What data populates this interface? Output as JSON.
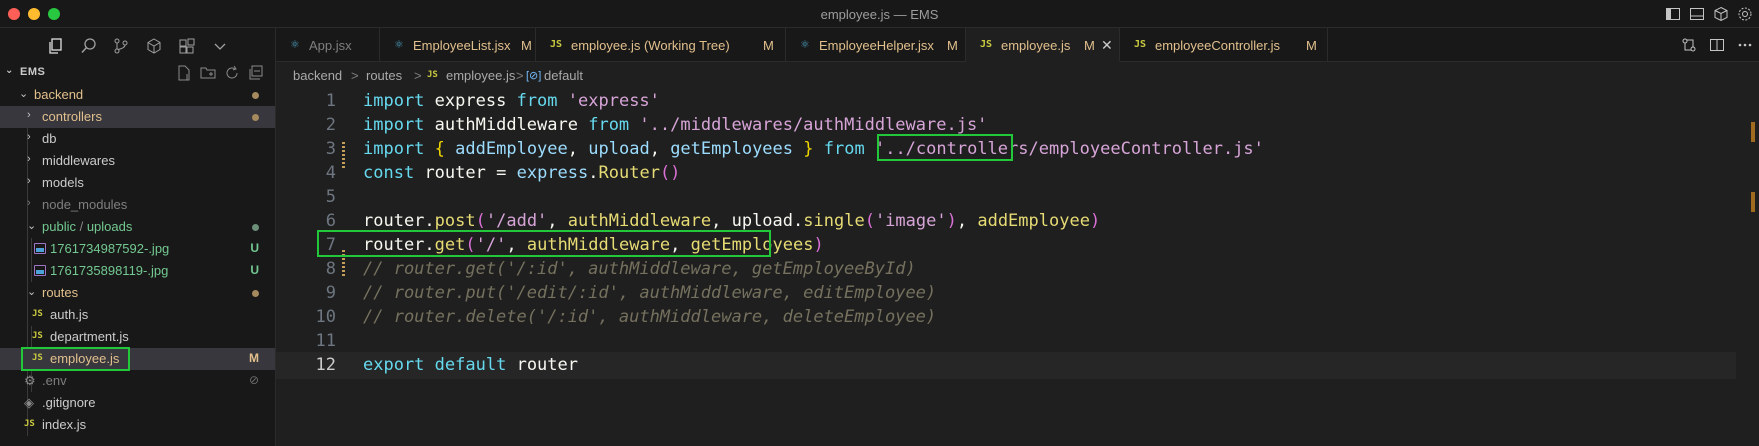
{
  "window": {
    "title": "employee.js — EMS"
  },
  "sidebar": {
    "section_title": "EMS",
    "tree": [
      {
        "label": "backend",
        "kind": "folder",
        "open": true,
        "depth": 0,
        "status": "dot"
      },
      {
        "label": "controllers",
        "kind": "folder",
        "open": false,
        "depth": 1,
        "status": "dot",
        "selected": true
      },
      {
        "label": "db",
        "kind": "folder",
        "open": false,
        "depth": 1
      },
      {
        "label": "middlewares",
        "kind": "folder",
        "open": false,
        "depth": 1
      },
      {
        "label": "models",
        "kind": "folder",
        "open": false,
        "depth": 1
      },
      {
        "label": "node_modules",
        "kind": "folder",
        "open": false,
        "depth": 1,
        "dim": true
      },
      {
        "label": "public",
        "label2": "uploads",
        "kind": "folder",
        "open": true,
        "depth": 1,
        "status": "dot-gray"
      },
      {
        "label": "1761734987592-.jpg",
        "kind": "image",
        "depth": 2,
        "badge": "U"
      },
      {
        "label": "1761735898119-.jpg",
        "kind": "image",
        "depth": 2,
        "badge": "U"
      },
      {
        "label": "routes",
        "kind": "folder",
        "open": true,
        "depth": 1,
        "status": "dot"
      },
      {
        "label": "auth.js",
        "kind": "js",
        "depth": 2
      },
      {
        "label": "department.js",
        "kind": "js",
        "depth": 2
      },
      {
        "label": "employee.js",
        "kind": "js",
        "depth": 2,
        "badge": "M",
        "active": true
      },
      {
        "label": ".env",
        "kind": "gear",
        "depth": 1,
        "badge": "⊘"
      },
      {
        "label": ".gitignore",
        "kind": "gear",
        "depth": 1
      },
      {
        "label": "index.js",
        "kind": "js",
        "depth": 1
      }
    ]
  },
  "tabs": [
    {
      "label": "App.jsx",
      "icon": "react-icon",
      "modified": ""
    },
    {
      "label": "EmployeeList.jsx",
      "icon": "react-icon",
      "modified": "M"
    },
    {
      "label": "employee.js (Working Tree)",
      "icon": "js-icon",
      "modified": "M"
    },
    {
      "label": "EmployeeHelper.jsx",
      "icon": "react-icon",
      "modified": "M"
    },
    {
      "label": "employee.js",
      "icon": "js-icon",
      "modified": "M",
      "active": true
    },
    {
      "label": "employeeController.js",
      "icon": "js-icon",
      "modified": "M"
    }
  ],
  "breadcrumb": {
    "items": [
      "backend",
      "routes",
      "employee.js",
      "default"
    ],
    "separator": ">"
  },
  "editor": {
    "current_line": 12,
    "lines": [
      {
        "n": "1",
        "text": "import express from 'express'"
      },
      {
        "n": "2",
        "text": "import authMiddleware from '../middlewares/authMiddleware.js'"
      },
      {
        "n": "3",
        "text": "import { addEmployee, upload, getEmployees } from '../controllers/employeeController.js'"
      },
      {
        "n": "4",
        "text": "const router = express.Router()"
      },
      {
        "n": "5",
        "text": ""
      },
      {
        "n": "6",
        "text": "router.post('/add', authMiddleware, upload.single('image'), addEmployee)"
      },
      {
        "n": "7",
        "text": "router.get('/', authMiddleware, getEmployees)"
      },
      {
        "n": "8",
        "text": "// router.get('/:id', authMiddleware, getEmployeeById)"
      },
      {
        "n": "9",
        "text": "// router.put('/edit/:id', authMiddleware, editEmployee)"
      },
      {
        "n": "10",
        "text": "// router.delete('/:id', authMiddleware, deleteEmployee)"
      },
      {
        "n": "11",
        "text": ""
      },
      {
        "n": "12",
        "text": "export default router"
      }
    ]
  },
  "colors": {
    "highlight_box": "#22c83a",
    "modified": "#e2c08d",
    "untracked": "#73c991"
  }
}
